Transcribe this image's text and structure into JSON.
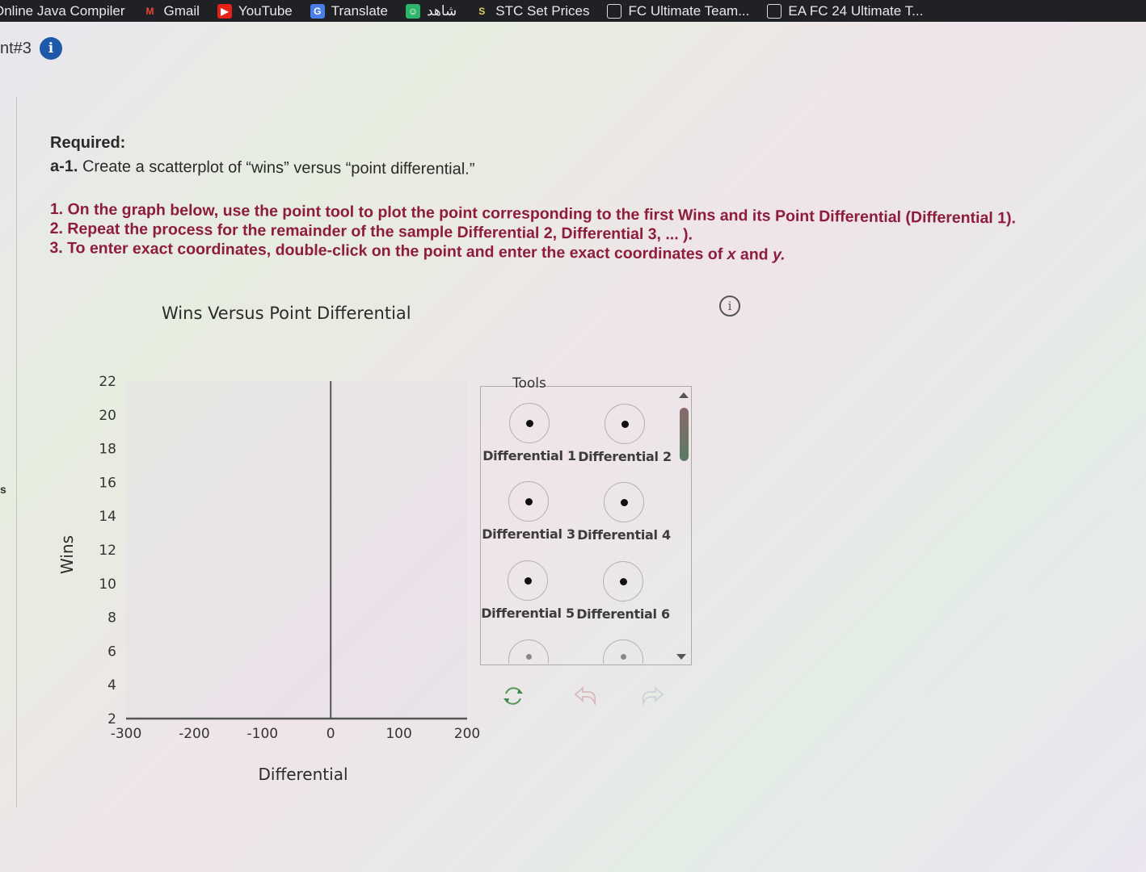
{
  "bookmarks": [
    {
      "label": "Online Java Compiler",
      "icon": "blank"
    },
    {
      "label": "Gmail",
      "icon": "gmail-icon"
    },
    {
      "label": "YouTube",
      "icon": "youtube-icon"
    },
    {
      "label": "Translate",
      "icon": "translate-icon"
    },
    {
      "label": "شاهد",
      "icon": "shahid-icon"
    },
    {
      "label": "STC Set Prices",
      "icon": "stc-icon"
    },
    {
      "label": "FC Ultimate Team...",
      "icon": "document-icon"
    },
    {
      "label": "EA FC 24 Ultimate T...",
      "icon": "document-icon"
    }
  ],
  "header": {
    "title_fragment": "nt#3",
    "info_glyph": "i"
  },
  "left_edge_text": "s",
  "question": {
    "required_label": "Required:",
    "part_label": "a-1.",
    "part_text": " Create a scatterplot of “wins” versus “point differential.”",
    "instructions": [
      "1. On the graph below, use the point tool to plot the point corresponding to the first Wins and its Point Differential (Differential 1).",
      "2. Repeat the process for the remainder of the sample Differential 2, Differential 3, ... ).",
      "3. To enter exact coordinates, double-click on the point and enter the exact coordinates of "
    ],
    "instruction3_x": "x",
    "instruction3_and": " and ",
    "instruction3_y": "y."
  },
  "chart_data": {
    "type": "scatter",
    "title": "Wins Versus Point Differential",
    "xlabel": "Differential",
    "ylabel": "Wins",
    "xlim": [
      -300,
      200
    ],
    "ylim": [
      2,
      22
    ],
    "xticks": [
      -300,
      -200,
      -100,
      0,
      100,
      200
    ],
    "yticks": [
      2,
      4,
      6,
      8,
      10,
      12,
      14,
      16,
      18,
      20,
      22
    ],
    "grid": false,
    "points": [],
    "info_glyph": "i"
  },
  "tools": {
    "legend": "Tools",
    "items": [
      {
        "label": "Differential 1"
      },
      {
        "label": "Differential 2"
      },
      {
        "label": "Differential 3"
      },
      {
        "label": "Differential 4"
      },
      {
        "label": "Differential 5"
      },
      {
        "label": "Differential 6"
      }
    ]
  },
  "actions": {
    "reset": "reset-icon",
    "undo": "undo-icon",
    "redo": "redo-icon"
  }
}
